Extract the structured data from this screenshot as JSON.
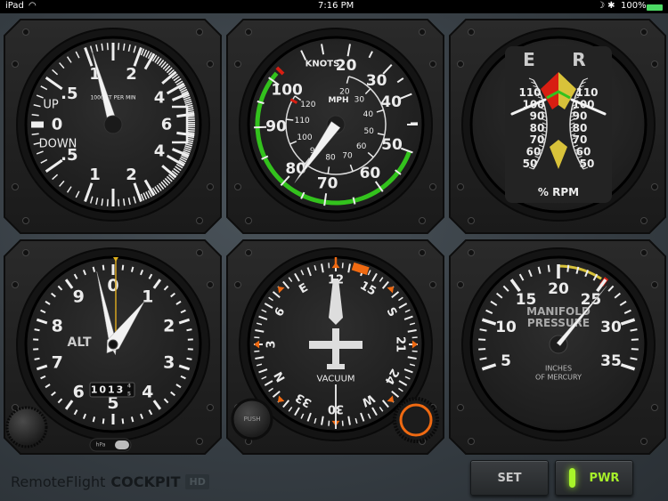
{
  "status_bar": {
    "device": "iPad",
    "time": "7:16 PM",
    "battery": "100%"
  },
  "brand": {
    "name": "RemoteFlight",
    "product": "COCKPIT",
    "badge": "HD"
  },
  "buttons": {
    "set": "SET",
    "pwr": "PWR"
  },
  "colors": {
    "green": "#33c21d",
    "red": "#d81e12",
    "yellow": "#d8c23a",
    "orange": "#f06a12",
    "needle": "#f2f2f2",
    "face": "#262626"
  },
  "vsi": {
    "up_label": "UP",
    "down_label": "DOWN",
    "unit_label": "1000 FT PER MIN",
    "zero": "0",
    "up": [
      {
        "v": 0.5,
        "t": ".5"
      },
      {
        "v": 1,
        "t": "1"
      },
      {
        "v": 2,
        "t": "2"
      },
      {
        "v": 4,
        "t": "4"
      },
      {
        "v": 6,
        "t": "6"
      }
    ],
    "down": [
      {
        "v": 0.5,
        "t": ".5"
      },
      {
        "v": 1,
        "t": "1"
      },
      {
        "v": 2,
        "t": "2"
      },
      {
        "v": 4,
        "t": "4"
      }
    ],
    "value_up": 1.1
  },
  "asi": {
    "knots_label": "KNOTS",
    "mph_label": "MPH",
    "knots": [
      20,
      30,
      40,
      50,
      60,
      70,
      80,
      90,
      100
    ],
    "mph": [
      20,
      30,
      40,
      50,
      60,
      70,
      80,
      90,
      100,
      110,
      120
    ],
    "green_range": [
      50,
      102
    ],
    "red_mark": 103,
    "value_knots": 78
  },
  "rpm": {
    "left_label": "E",
    "right_label": "R",
    "unit_label": "% RPM",
    "scale": [
      110,
      100,
      90,
      80,
      70,
      60,
      50
    ],
    "engine_value": 104,
    "rotor_value": 104
  },
  "alt": {
    "label": "ALT",
    "numbers": [
      "0",
      "1",
      "2",
      "3",
      "4",
      "5",
      "6",
      "7",
      "8",
      "9"
    ],
    "kollsman": "1013",
    "kollsman_next": "4",
    "kollsman_sub": "5",
    "unit_toggle": "hPa",
    "long_needle": 9.65,
    "short_needle": 1.0
  },
  "hdg": {
    "label": "VACUUM",
    "push_label": "PUSH",
    "heading": 120,
    "card": [
      {
        "h": 0,
        "t": "N"
      },
      {
        "h": 30,
        "t": "3"
      },
      {
        "h": 60,
        "t": "6"
      },
      {
        "h": 90,
        "t": "E"
      },
      {
        "h": 120,
        "t": "12"
      },
      {
        "h": 150,
        "t": "15"
      },
      {
        "h": 180,
        "t": "S"
      },
      {
        "h": 210,
        "t": "21"
      },
      {
        "h": 240,
        "t": "24"
      },
      {
        "h": 270,
        "t": "W"
      },
      {
        "h": 300,
        "t": "30"
      },
      {
        "h": 330,
        "t": "33"
      }
    ],
    "bug_heading": 138
  },
  "mp": {
    "label_line1": "MANIFOLD",
    "label_line2": "PRESSURE",
    "unit_line1": "INCHES",
    "unit_line2": "OF MERCURY",
    "scale": [
      5,
      10,
      15,
      20,
      25,
      30,
      35
    ],
    "yellow_range": [
      20,
      24.6
    ],
    "red_mark": 25,
    "value": 25.5
  }
}
